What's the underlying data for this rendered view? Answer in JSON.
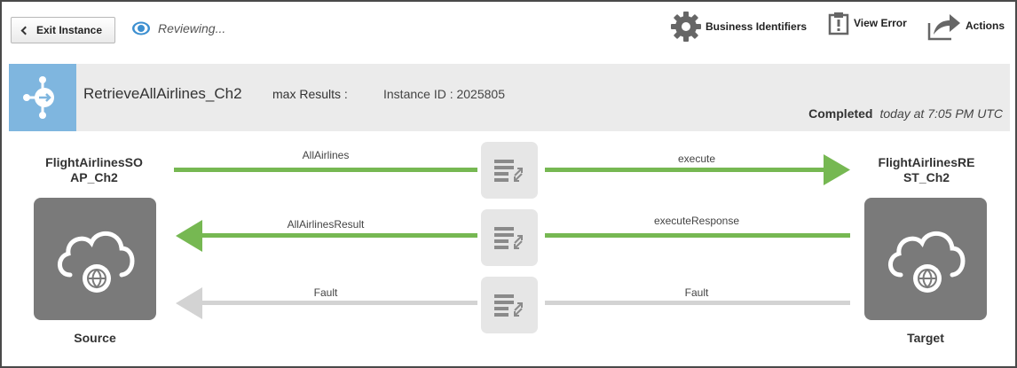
{
  "toolbar": {
    "exit_label": "Exit Instance",
    "status_text": "Reviewing...",
    "business_identifiers_label": "Business Identifiers",
    "view_error_label": "View Error",
    "actions_label": "Actions"
  },
  "header": {
    "flow_name": "RetrieveAllAirlines_Ch2",
    "max_results_label": "max Results :",
    "instance_id_label": "Instance ID : 2025805",
    "status": "Completed",
    "time": "today at 7:05 PM UTC"
  },
  "flow": {
    "source": {
      "name": "FlightAirlinesSO\nAP_Ch2",
      "role": "Source"
    },
    "target": {
      "name": "FlightAirlinesRE\nST_Ch2",
      "role": "Target"
    },
    "messages": [
      {
        "left_label": "AllAirlines",
        "right_label": "execute",
        "direction": "right",
        "active": true
      },
      {
        "left_label": "AllAirlinesResult",
        "right_label": "executeResponse",
        "direction": "left",
        "active": true
      },
      {
        "left_label": "Fault",
        "right_label": "Fault",
        "direction": "left",
        "active": false
      }
    ]
  },
  "colors": {
    "active_arrow": "#76b852",
    "inactive_arrow": "#d3d3d3",
    "endpoint_box": "#7a7a7a",
    "header_icon_bg": "#7fb6df",
    "header_band": "#ebebeb"
  }
}
